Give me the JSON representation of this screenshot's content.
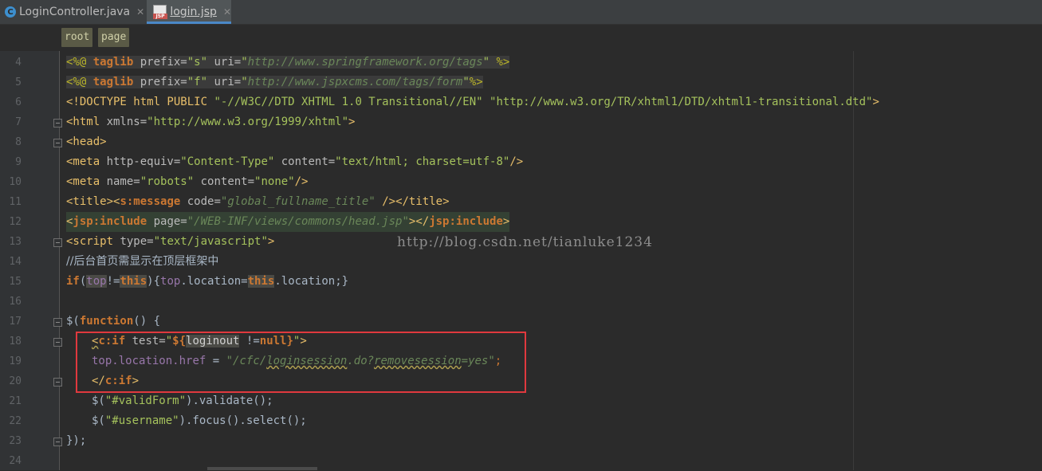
{
  "tabs": [
    {
      "label": "LoginController.java",
      "icon": "java-class-icon",
      "close": "✕",
      "active": false
    },
    {
      "label": "login.jsp",
      "icon": "jsp-file-icon",
      "close": "✕",
      "active": true
    }
  ],
  "jsp_badge": "JSP",
  "java_badge": "C",
  "breadcrumbs": [
    "root",
    "page"
  ],
  "watermark": "http://blog.csdn.net/tianluke1234",
  "line_numbers": [
    "4",
    "5",
    "6",
    "7",
    "8",
    "9",
    "10",
    "11",
    "12",
    "13",
    "14",
    "15",
    "16",
    "17",
    "18",
    "19",
    "20",
    "21",
    "22",
    "23",
    "24"
  ],
  "code": {
    "l4": [
      "<%@ ",
      "taglib",
      " prefix=",
      "\"s\"",
      " uri=",
      "\"",
      "http://www.springframework.org/tags",
      "\"",
      " %>"
    ],
    "l5": [
      "<%@ ",
      "taglib",
      " prefix=",
      "\"f\"",
      " uri=",
      "\"",
      "http://www.jspxcms.com/tags/form",
      "\"",
      "%>"
    ],
    "l6": [
      "<!DOCTYPE html PUBLIC ",
      "\"-//W3C//DTD XHTML 1.0 Transitional//EN\"",
      " ",
      "\"http://www.w3.org/TR/xhtml1/DTD/xhtml1-transitional.dtd\"",
      ">"
    ],
    "l7": [
      "<html ",
      "xmlns=",
      "\"http://www.w3.org/1999/xhtml\"",
      ">"
    ],
    "l8": [
      "<head>"
    ],
    "l9": [
      "<meta ",
      "http-equiv=",
      "\"Content-Type\"",
      " content=",
      "\"text/html; charset=utf-8\"",
      "/>"
    ],
    "l10": [
      "<meta ",
      "name=",
      "\"robots\"",
      " content=",
      "\"none\"",
      "/>"
    ],
    "l11": [
      "<title>",
      "<",
      "s:message",
      " code=",
      "\"global_fullname_title\"",
      " />",
      "</title>"
    ],
    "l12": [
      "<",
      "jsp:include",
      " page=",
      "\"/WEB-INF/views/commons/head.jsp\"",
      "></",
      "jsp:include",
      ">"
    ],
    "l13": [
      "<script ",
      "type=",
      "\"text/javascript\"",
      ">"
    ],
    "l14": [
      "//后台首页需显示在顶层框架中"
    ],
    "l15": [
      "if",
      "(",
      "top",
      "!=",
      "this",
      "){",
      "top",
      ".location=",
      "this",
      ".location;}"
    ],
    "l16": [
      ""
    ],
    "l17": [
      "$(",
      "function",
      "() {"
    ],
    "l18": [
      "<",
      "c:if",
      " test=",
      "\"",
      "${",
      "loginout",
      " !=",
      "null",
      "}",
      "\"",
      ">"
    ],
    "l19": [
      "top",
      ".location.",
      "href",
      " = ",
      "\"/cfc/",
      "loginsession",
      ".do?",
      "removesession",
      "=yes\"",
      ";"
    ],
    "l20": [
      "</",
      "c:if",
      ">"
    ],
    "l21": [
      "$(",
      "\"#validForm\"",
      ").validate();"
    ],
    "l22": [
      "$(",
      "\"#username\"",
      ").focus().select();"
    ],
    "l23": [
      "});"
    ],
    "l24": [
      ""
    ]
  },
  "colors": {
    "editor_bg": "#2b2b2b",
    "gutter_bg": "#313335",
    "tag": "#e8bf6a",
    "keyword": "#cc7832",
    "string": "#a5c25c",
    "highlight_box": "#e0393e",
    "tab_accent": "#4a88c7"
  }
}
